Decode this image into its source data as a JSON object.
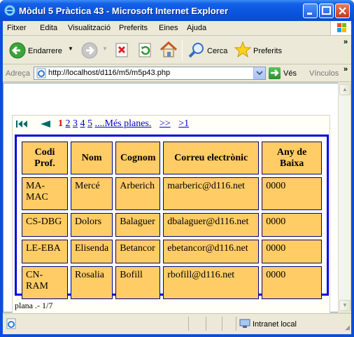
{
  "window": {
    "title": "Mòdul 5 Pràctica 43 - Microsoft Internet Explorer"
  },
  "menu": {
    "items": [
      "Fitxer",
      "Edita",
      "Visualització",
      "Preferits",
      "Eines",
      "Ajuda"
    ]
  },
  "toolbar": {
    "back_label": "Endarrere",
    "search_label": "Cerca",
    "favorites_label": "Preferits"
  },
  "address": {
    "label": "Adreça",
    "url": "http://localhost/d116/m5/m5p43.php",
    "go_label": "Vés",
    "links_label": "Vínculos"
  },
  "pager": {
    "current": "1",
    "pages": [
      "2",
      "3",
      "4",
      "5"
    ],
    "more": "....Més planes.",
    "next": ">>",
    "last": ">1"
  },
  "table": {
    "headers": [
      "Codi Prof.",
      "Nom",
      "Cognom",
      "Correu electrònic",
      "Any de Baixa"
    ],
    "rows": [
      [
        "MA-MAC",
        "Mercé",
        "Arberich",
        "marberic@d116.net",
        "0000"
      ],
      [
        "CS-DBG",
        "Dolors",
        "Balaguer",
        "dbalaguer@d116.net",
        "0000"
      ],
      [
        "LE-EBA",
        "Elisenda",
        "Betancor",
        "ebetancor@d116.net",
        "0000"
      ],
      [
        "CN-RAM",
        "Rosalia",
        "Bofill",
        "rbofill@d116.net",
        "0000"
      ]
    ]
  },
  "footer": {
    "page_info": "plana .- 1/7"
  },
  "status": {
    "zone": "Intranet local"
  },
  "colors": {
    "header_cell_bg": "#ffcc66",
    "table_border": "#0000e0",
    "current_page": "#e00000",
    "link": "#0000cc"
  }
}
